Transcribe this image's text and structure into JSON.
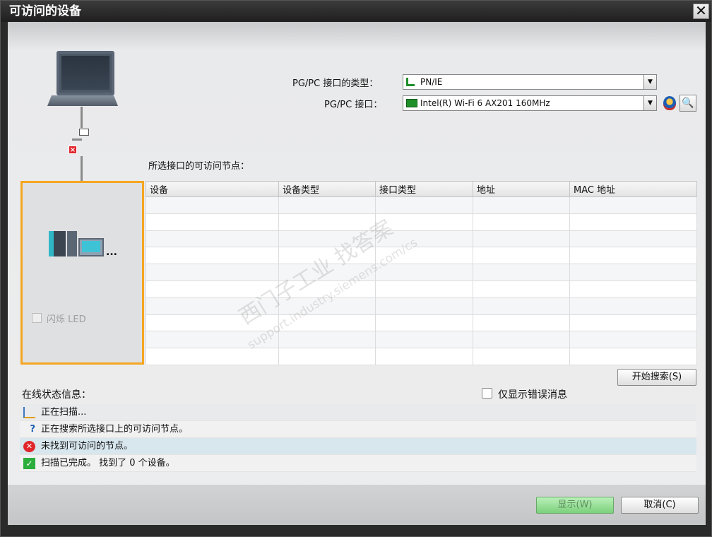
{
  "window": {
    "title": "可访问的设备",
    "close_glyph": "✕"
  },
  "left": {
    "flash_led_label": "闪烁 LED",
    "device_dots": "..."
  },
  "interface": {
    "type_label": "PG/PC 接口的类型：",
    "type_value": "PN/IE",
    "iface_label": "PG/PC 接口：",
    "iface_value": "Intel(R) Wi-Fi 6 AX201 160MHz",
    "type_icon": "network-plug-icon",
    "iface_icon": "network-card-icon"
  },
  "nodes": {
    "title": "所选接口的可访问节点：",
    "columns": [
      "设备",
      "设备类型",
      "接口类型",
      "地址",
      "MAC 地址"
    ]
  },
  "search_button": "开始搜索(S)",
  "status": {
    "title": "在线状态信息：",
    "errors_only_label": "仅显示错误消息",
    "rows": [
      {
        "icon": "scan-icon",
        "text": "正在扫描..."
      },
      {
        "icon": "search-nodes-icon",
        "text": "正在搜索所选接口上的可访问节点。"
      },
      {
        "icon": "error-icon",
        "text": "未找到可访问的节点。"
      },
      {
        "icon": "success-icon",
        "text": "扫描已完成。 找到了 0 个设备。"
      }
    ]
  },
  "buttons": {
    "show": "显示(W)",
    "cancel": "取消(C)"
  },
  "watermark": {
    "line1": "西门子工业  找答案",
    "line2": "support.industry.siemens.com/cs"
  },
  "colors": {
    "highlight_frame": "#f4a621",
    "show_button": "#7cd07c",
    "error": "#e0262b",
    "success": "#2bae3c"
  }
}
